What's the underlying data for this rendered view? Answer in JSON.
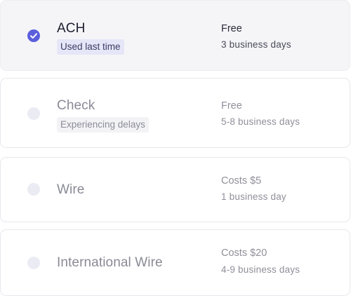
{
  "options": [
    {
      "method": "ACH",
      "tag": "Used last time",
      "fee": "Free",
      "eta": "3 business days",
      "selected": true
    },
    {
      "method": "Check",
      "tag": "Experiencing delays",
      "fee": "Free",
      "eta": "5-8 business days",
      "selected": false
    },
    {
      "method": "Wire",
      "fee": "Costs $5",
      "eta": "1 business day",
      "selected": false
    },
    {
      "method": "International Wire",
      "fee": "Costs $20",
      "eta": "4-9 business days",
      "selected": false
    }
  ],
  "colors": {
    "accent": "#5b5fdc",
    "selected_bg": "#f5f5f8",
    "used_tag_bg": "#e5e6f7"
  },
  "icons": {
    "checked": "check-icon"
  }
}
